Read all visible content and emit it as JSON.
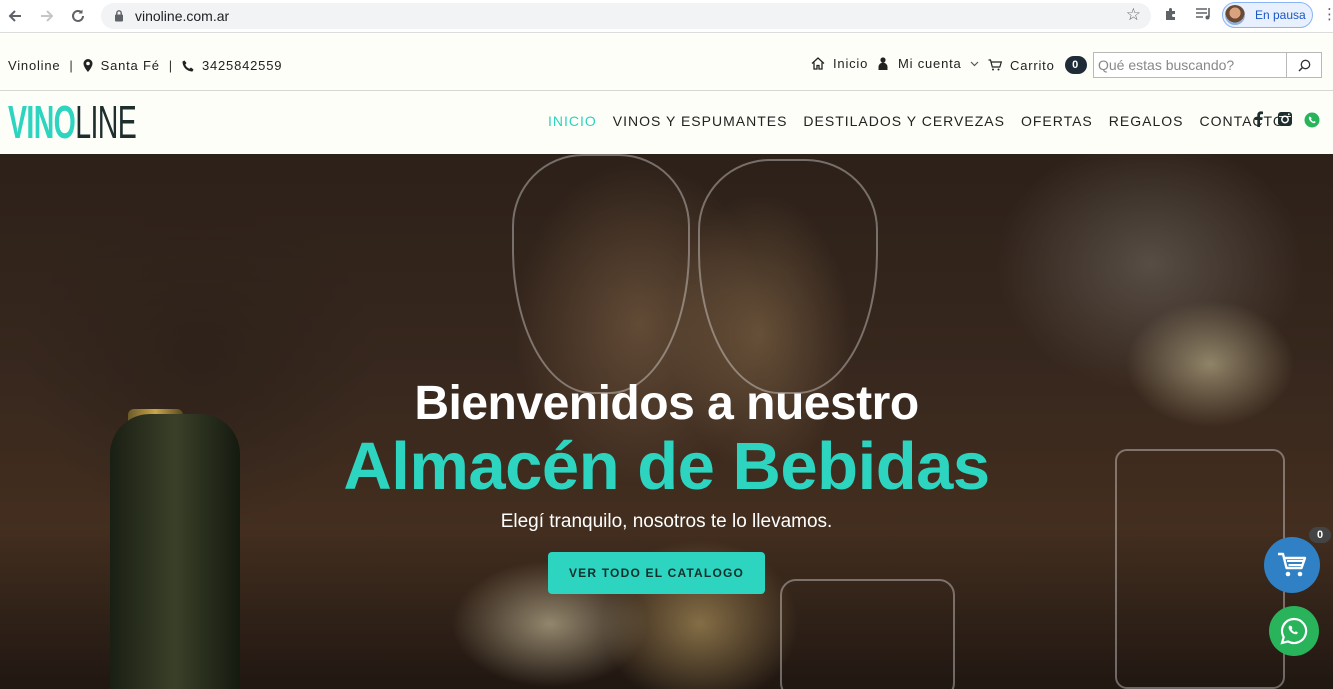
{
  "browser": {
    "url": "vinoline.com.ar",
    "profile_status": "En pausa"
  },
  "topbar": {
    "brand": "Vinoline",
    "location": "Santa Fé",
    "phone": "3425842559",
    "home_label": "Inicio",
    "account_label": "Mi cuenta",
    "cart_label": "Carrito",
    "cart_count": "0",
    "search_placeholder": "Qué estas buscando?"
  },
  "header": {
    "logo_part1": "VINO",
    "logo_part2": "LINE",
    "menu": [
      {
        "label": "INICIO",
        "active": true
      },
      {
        "label": "VINOS Y ESPUMANTES",
        "active": false
      },
      {
        "label": "DESTILADOS Y CERVEZAS",
        "active": false
      },
      {
        "label": "OFERTAS",
        "active": false
      },
      {
        "label": "REGALOS",
        "active": false
      },
      {
        "label": "CONTACTO",
        "active": false
      }
    ],
    "social_icons": [
      "facebook-icon",
      "instagram-icon",
      "whatsapp-icon"
    ]
  },
  "hero": {
    "title_line1": "Bienvenidos a nuestro",
    "title_line2": "Almacén de Bebidas",
    "subtitle": "Elegí tranquilo, nosotros te lo llevamos.",
    "cta_label": "VER TODO EL CATALOGO"
  },
  "floating": {
    "cart_count": "0"
  },
  "colors": {
    "accent": "#2dd4bf",
    "cart_fab": "#2f80c4",
    "whatsapp": "#29b35b",
    "dark": "#1f2b36"
  }
}
